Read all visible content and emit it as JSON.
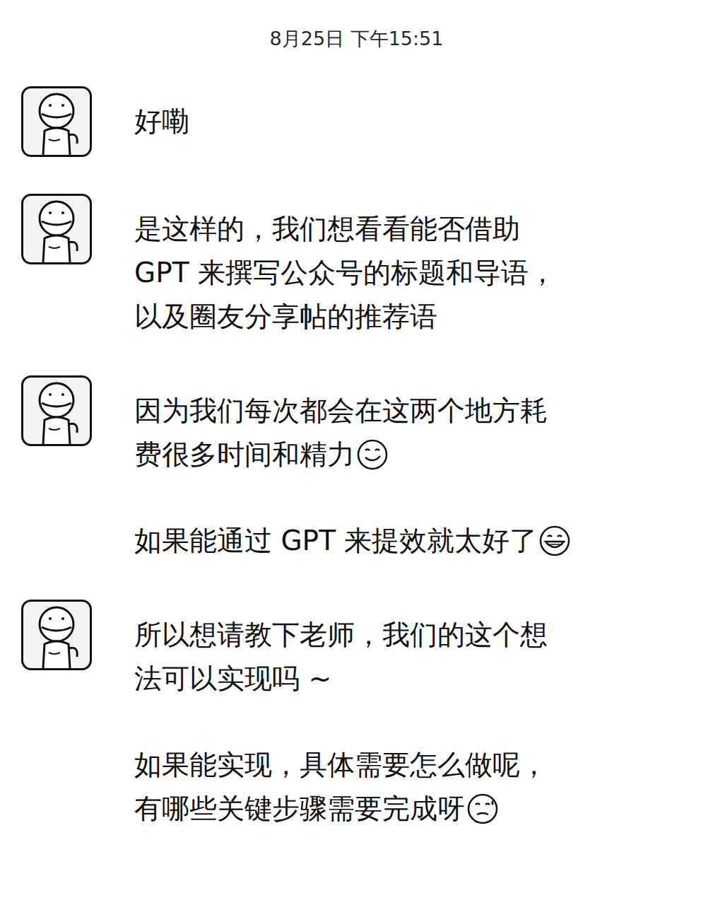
{
  "timestamp": "8月25日 下午15:51",
  "messages": [
    {
      "show_avatar": true,
      "paragraphs": [
        {
          "lines": [
            "好嘞"
          ],
          "emoji": false,
          "emoji_kind": "none"
        }
      ]
    },
    {
      "show_avatar": true,
      "paragraphs": [
        {
          "lines": [
            "是这样的，我们想看看能否借助",
            "GPT 来撰写公众号的标题和导语，",
            "以及圈友分享帖的推荐语"
          ],
          "emoji": false,
          "emoji_kind": "none"
        }
      ]
    },
    {
      "show_avatar": true,
      "paragraphs": [
        {
          "lines": [
            "因为我们每次都会在这两个地方耗",
            "费很多时间和精力"
          ],
          "emoji": true,
          "emoji_kind": "smirk"
        },
        {
          "lines": [
            "如果能通过 GPT 来提效就太好了"
          ],
          "emoji": true,
          "emoji_kind": "grin"
        }
      ]
    },
    {
      "show_avatar": true,
      "paragraphs": [
        {
          "lines": [
            "所以想请教下老师，我们的这个想",
            "法可以实现吗 ~"
          ],
          "emoji": false,
          "emoji_kind": "none"
        },
        {
          "lines": [
            "如果能实现，具体需要怎么做呢，",
            "有哪些关键步骤需要完成呀"
          ],
          "emoji": true,
          "emoji_kind": "sweat"
        }
      ]
    }
  ]
}
